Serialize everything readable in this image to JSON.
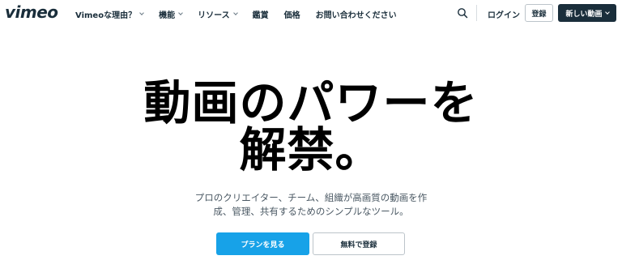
{
  "brand": {
    "logo_text": "vimeo"
  },
  "nav": {
    "items": [
      {
        "label": "Vimeoな理由？",
        "has_dropdown": true
      },
      {
        "label": "機能",
        "has_dropdown": true
      },
      {
        "label": "リソース",
        "has_dropdown": true
      },
      {
        "label": "鑑賞",
        "has_dropdown": false
      },
      {
        "label": "価格",
        "has_dropdown": false
      },
      {
        "label": "お問い合わせください",
        "has_dropdown": false
      }
    ],
    "search_icon": "search-icon",
    "login_label": "ログイン",
    "signup_label": "登録",
    "new_video_label": "新しい動画"
  },
  "hero": {
    "title_line1": "動画のパワーを",
    "title_line2": "解禁。",
    "subtitle_line1": "プロのクリエイター、チーム、組織が高画質の動画を作",
    "subtitle_line2": "成、管理、共有するためのシンプルなツール。",
    "primary_cta": "プランを見る",
    "secondary_cta": "無料で登録"
  },
  "colors": {
    "brand_dark": "#1a2e3b",
    "accent_blue": "#17a2e8",
    "background": "#ffffff"
  }
}
